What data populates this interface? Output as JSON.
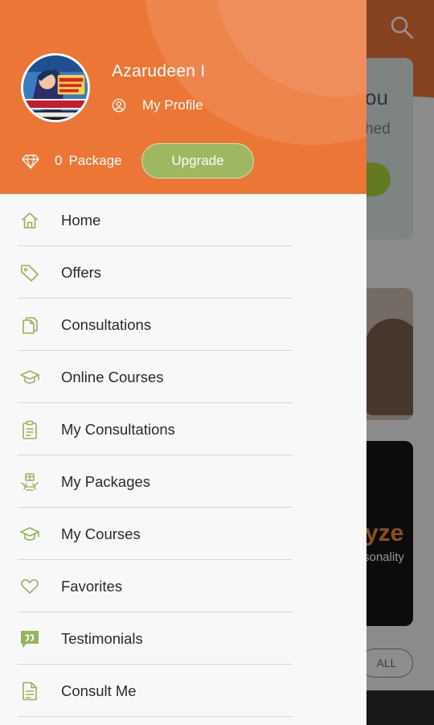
{
  "background": {
    "card_1": {
      "line_1": "ou",
      "line_2": "hed"
    },
    "card_3": {
      "headline": "yze",
      "subline": "sonality"
    },
    "chip_all": "ALL"
  },
  "drawer": {
    "user": {
      "name": "Azarudeen I",
      "profile_link": "My Profile",
      "avatar_icon": "avatar-image"
    },
    "package": {
      "count": "0",
      "label": "Package",
      "upgrade_label": "Upgrade"
    },
    "menu": [
      {
        "label": "Home",
        "icon": "home-icon"
      },
      {
        "label": "Offers",
        "icon": "tag-icon"
      },
      {
        "label": "Consultations",
        "icon": "copy-documents-icon"
      },
      {
        "label": "Online Courses",
        "icon": "graduation-cap-icon"
      },
      {
        "label": "My Consultations",
        "icon": "clipboard-icon"
      },
      {
        "label": "My Packages",
        "icon": "package-hands-icon"
      },
      {
        "label": "My Courses",
        "icon": "graduation-cap-icon"
      },
      {
        "label": "Favorites",
        "icon": "heart-icon"
      },
      {
        "label": "Testimonials",
        "icon": "quote-icon"
      },
      {
        "label": "Consult Me",
        "icon": "document-icon"
      }
    ]
  },
  "colors": {
    "header_orange": "#ec7636",
    "accent_green": "#9db860",
    "icon_green": "#94b35a",
    "drawer_bg": "#f8f8f8"
  }
}
